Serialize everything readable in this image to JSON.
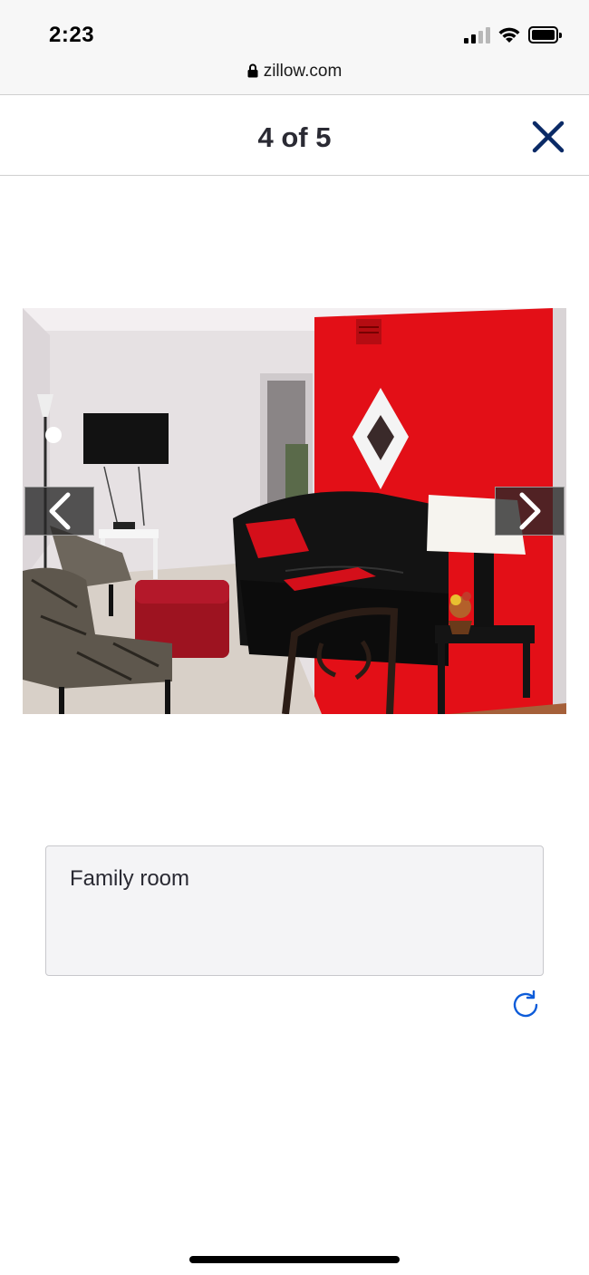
{
  "status_bar": {
    "time": "2:23",
    "signal_bars_filled": 2,
    "signal_bars_total": 4
  },
  "browser": {
    "url": "zillow.com"
  },
  "viewer": {
    "counter": "4 of 5",
    "current_index": 4,
    "total": 5,
    "close_icon": "close-icon",
    "prev_icon": "chevron-left-icon",
    "next_icon": "chevron-right-icon"
  },
  "caption": {
    "text": "Family room",
    "refresh_icon": "refresh-icon"
  },
  "colors": {
    "accent_blue": "#0d5cd9",
    "close_navy": "#0a2a66",
    "text_dark": "#2a2a33"
  }
}
